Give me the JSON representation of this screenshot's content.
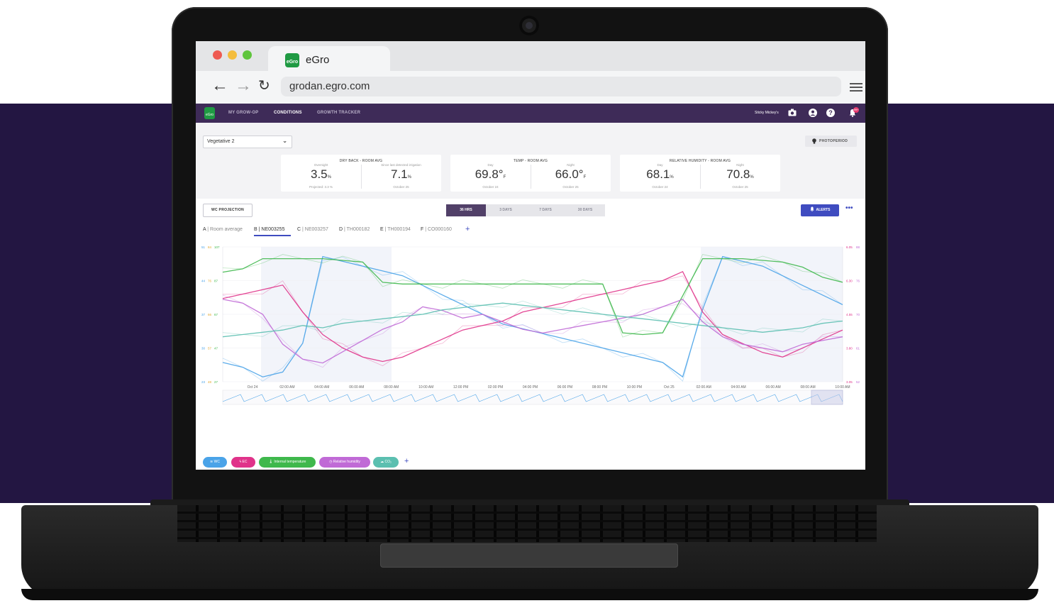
{
  "browser": {
    "tab_title": "eGro",
    "tab_logo_text": "eGro",
    "url": "grodan.egro.com"
  },
  "appnav": {
    "logo_text": "eGro",
    "links": [
      "MY GROW-OP",
      "CONDITIONS",
      "GROWTH TRACKER"
    ],
    "user": "Sticky Mickey's",
    "notif_count": "99+"
  },
  "toolbar": {
    "stage_select": "Vegetative 2",
    "photoperiod_label": "PHOTOPERIOD"
  },
  "cards": [
    {
      "title": "DRY BACK - ROOM AVG",
      "metrics": [
        {
          "label": "Overnight",
          "value": "3.5",
          "unit": "%",
          "sub": "Projected: 3.3 %"
        },
        {
          "label": "Since last detected irrigation",
          "value": "7.1",
          "unit": "%",
          "sub": "October 25"
        }
      ]
    },
    {
      "title": "TEMP - ROOM AVG",
      "metrics": [
        {
          "label": "Day",
          "value": "69.8°",
          "unit": "F",
          "sub": "October 24"
        },
        {
          "label": "Night",
          "value": "66.0°",
          "unit": "F",
          "sub": "October 25"
        }
      ]
    },
    {
      "title": "RELATIVE HUMIDITY - ROOM AVG",
      "metrics": [
        {
          "label": "Day",
          "value": "68.1",
          "unit": "%",
          "sub": "October 24"
        },
        {
          "label": "Night",
          "value": "70.8",
          "unit": "%",
          "sub": "October 25"
        }
      ]
    }
  ],
  "panel": {
    "wc_projection_label": "WC PROJECTION",
    "ranges": [
      "36 HRS",
      "3 DAYS",
      "7 DAYS",
      "30 DAYS"
    ],
    "active_range": "36 HRS",
    "alerts_label": "ALERTS",
    "more_label": "•••",
    "sensors": [
      {
        "letter": "A",
        "name": "Room average"
      },
      {
        "letter": "B",
        "name": "NE003255"
      },
      {
        "letter": "C",
        "name": "NE003257"
      },
      {
        "letter": "D",
        "name": "TH000182"
      },
      {
        "letter": "E",
        "name": "TH000194"
      },
      {
        "letter": "F",
        "name": "CO000160"
      }
    ],
    "active_sensor": "B",
    "add_label": "+"
  },
  "chart_data": {
    "type": "line",
    "x_ticks": [
      "Oct 24",
      "02:00 AM",
      "04:00 AM",
      "06:00 AM",
      "08:00 AM",
      "10:00 AM",
      "12:00 PM",
      "02:00 PM",
      "04:00 PM",
      "06:00 PM",
      "08:00 PM",
      "10:00 PM",
      "Oct 25",
      "02:00 AM",
      "04:00 AM",
      "06:00 AM",
      "08:00 AM",
      "10:00 AM"
    ],
    "left_axes": [
      {
        "color": "#4aa3e8",
        "ticks": [
          "51",
          "44",
          "37",
          "30",
          "23"
        ]
      },
      {
        "color": "#e3a82e",
        "ticks": [
          "84",
          "76",
          "66",
          "57",
          "48"
        ]
      },
      {
        "color": "#3fb84c",
        "ticks": [
          "107",
          "87",
          "67",
          "47",
          "27"
        ]
      }
    ],
    "right_axes": [
      {
        "color": "#e0338a",
        "ticks": [
          "6.05",
          "6.30",
          "4.55",
          "3.80",
          "3.05"
        ]
      },
      {
        "color": "#c06ad6",
        "ticks": [
          "88",
          "76",
          "70",
          "61",
          "52"
        ]
      }
    ],
    "series": [
      {
        "name": "WC",
        "color": "#4aa3e8",
        "values": [
          27,
          26,
          24,
          25,
          31,
          49,
          48,
          47,
          46,
          45,
          43,
          41,
          39,
          37,
          35,
          34,
          33,
          32,
          31,
          30,
          29,
          28,
          27,
          24,
          38,
          49,
          48,
          47,
          45,
          43,
          41,
          39
        ]
      },
      {
        "name": "EC",
        "color": "#e0338a",
        "values": [
          4.9,
          5.0,
          5.1,
          5.2,
          4.6,
          4.1,
          3.8,
          3.6,
          3.5,
          3.6,
          3.8,
          4.0,
          4.2,
          4.3,
          4.4,
          4.6,
          4.7,
          4.8,
          4.9,
          5.0,
          5.1,
          5.2,
          5.3,
          5.5,
          4.6,
          4.1,
          3.9,
          3.7,
          3.6,
          3.8,
          4.0,
          4.2
        ]
      },
      {
        "name": "Internal temperature",
        "color": "#3fb84c",
        "values": [
          92,
          94,
          100,
          100,
          100,
          100,
          99,
          98,
          86,
          85,
          85,
          85,
          85,
          85,
          85,
          85,
          85,
          85,
          85,
          85,
          56,
          55,
          56,
          78,
          100,
          100,
          100,
          99,
          98,
          95,
          89,
          86
        ]
      },
      {
        "name": "Relative humidity",
        "color": "#c06ad6",
        "values": [
          74,
          73,
          70,
          62,
          58,
          57,
          60,
          63,
          66,
          68,
          72,
          71,
          69,
          70,
          68,
          66,
          65,
          66,
          67,
          68,
          69,
          70,
          72,
          74,
          68,
          64,
          62,
          61,
          60,
          62,
          63,
          64
        ]
      },
      {
        "name": "CO₂",
        "color": "#5bbfb0",
        "values": [
          60,
          61,
          62,
          63,
          65,
          64,
          66,
          67,
          68,
          69,
          70,
          72,
          73,
          74,
          75,
          74,
          73,
          72,
          71,
          70,
          69,
          68,
          67,
          66,
          65,
          64,
          63,
          62,
          63,
          64,
          66,
          67
        ]
      }
    ]
  },
  "legend_chips": [
    {
      "label": "WC",
      "color": "#4aa3e8"
    },
    {
      "label": "EC",
      "color": "#e0338a"
    },
    {
      "label": "Internal temperature",
      "color": "#3fb84c"
    },
    {
      "label": "Relative humidity",
      "color": "#c06ad6"
    },
    {
      "label": "CO₂",
      "color": "#5bbfb0"
    }
  ],
  "legend_add": "+"
}
